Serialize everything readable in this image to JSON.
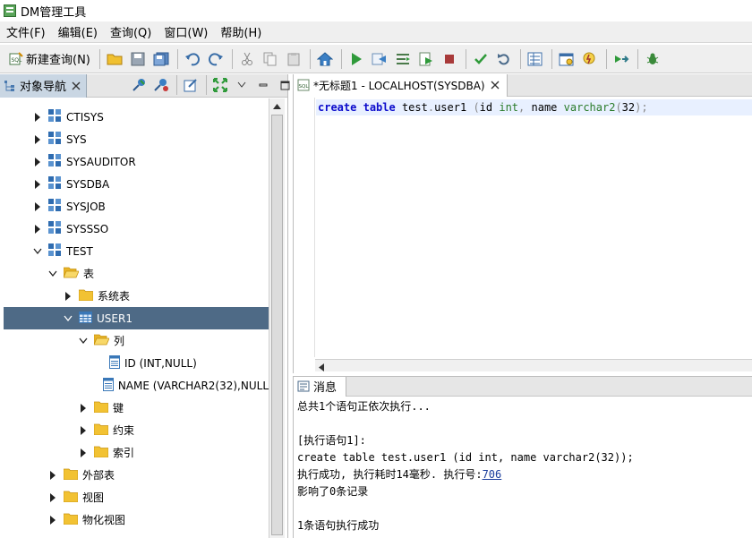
{
  "window": {
    "title": "DM管理工具"
  },
  "menu": [
    "文件(F)",
    "编辑(E)",
    "查询(Q)",
    "窗口(W)",
    "帮助(H)"
  ],
  "toolbar": {
    "new_query_label": "新建查询(N)",
    "icons": [
      "new-query-icon",
      "open-folder-icon",
      "save-icon",
      "save-all-icon",
      "undo-icon",
      "redo-icon",
      "cut-icon",
      "copy-icon",
      "paste-icon",
      "home-icon",
      "run-icon",
      "run-step-icon",
      "explain-icon",
      "run-script-icon",
      "stop-icon",
      "commit-icon",
      "rollback-icon",
      "plan-icon",
      "schedule-icon",
      "lightning-icon",
      "export-icon",
      "debug-icon"
    ]
  },
  "navigator": {
    "tab_label": "对象导航",
    "tree": [
      {
        "label": "CTISYS",
        "level": 1,
        "expanded": false,
        "kind": "schema"
      },
      {
        "label": "SYS",
        "level": 1,
        "expanded": false,
        "kind": "schema"
      },
      {
        "label": "SYSAUDITOR",
        "level": 1,
        "expanded": false,
        "kind": "schema"
      },
      {
        "label": "SYSDBA",
        "level": 1,
        "expanded": false,
        "kind": "schema"
      },
      {
        "label": "SYSJOB",
        "level": 1,
        "expanded": false,
        "kind": "schema"
      },
      {
        "label": "SYSSSO",
        "level": 1,
        "expanded": false,
        "kind": "schema"
      },
      {
        "label": "TEST",
        "level": 1,
        "expanded": true,
        "kind": "schema"
      },
      {
        "label": "表",
        "level": 2,
        "expanded": true,
        "kind": "folder-open"
      },
      {
        "label": "系统表",
        "level": 3,
        "expanded": false,
        "kind": "folder"
      },
      {
        "label": "USER1",
        "level": 3,
        "expanded": true,
        "kind": "table",
        "selected": true
      },
      {
        "label": "列",
        "level": 4,
        "expanded": true,
        "kind": "folder-open"
      },
      {
        "label": "ID (INT,NULL)",
        "level": 5,
        "expanded": null,
        "kind": "column"
      },
      {
        "label": "NAME (VARCHAR2(32),NULL",
        "level": 5,
        "expanded": null,
        "kind": "column"
      },
      {
        "label": "键",
        "level": 4,
        "expanded": false,
        "kind": "folder"
      },
      {
        "label": "约束",
        "level": 4,
        "expanded": false,
        "kind": "folder"
      },
      {
        "label": "索引",
        "level": 4,
        "expanded": false,
        "kind": "folder"
      },
      {
        "label": "外部表",
        "level": 2,
        "expanded": false,
        "kind": "folder"
      },
      {
        "label": "视图",
        "level": 2,
        "expanded": false,
        "kind": "folder"
      },
      {
        "label": "物化视图",
        "level": 2,
        "expanded": false,
        "kind": "folder"
      }
    ]
  },
  "editor": {
    "tab_label": "*无标题1 - LOCALHOST(SYSDBA)",
    "code_tokens": [
      {
        "t": "create",
        "c": "kw"
      },
      {
        "t": " ",
        "c": ""
      },
      {
        "t": "table",
        "c": "kw"
      },
      {
        "t": " test",
        "c": ""
      },
      {
        "t": ".",
        "c": "pl"
      },
      {
        "t": "user1 ",
        "c": ""
      },
      {
        "t": "(",
        "c": "pl"
      },
      {
        "t": "id ",
        "c": ""
      },
      {
        "t": "int",
        "c": "ty"
      },
      {
        "t": ",",
        "c": "pl"
      },
      {
        "t": " name ",
        "c": ""
      },
      {
        "t": "varchar2",
        "c": "ty"
      },
      {
        "t": "(",
        "c": "pl"
      },
      {
        "t": "32",
        "c": ""
      },
      {
        "t": ");",
        "c": "pl"
      }
    ]
  },
  "messages": {
    "tab_label": "消息",
    "lines": [
      "总共1个语句正依次执行...",
      "",
      "[执行语句1]:",
      "create table test.user1 (id int, name varchar2(32));",
      "执行成功, 执行耗时14毫秒. 执行号:",
      "影响了0条记录",
      "",
      "1条语句执行成功"
    ],
    "exec_no": "706"
  }
}
